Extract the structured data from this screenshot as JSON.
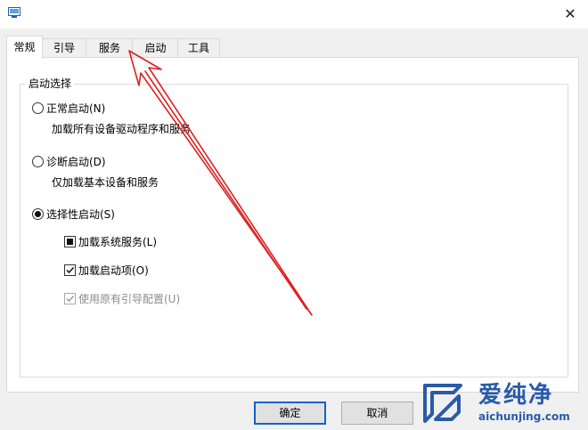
{
  "window": {
    "icon": "msconfig-icon",
    "close_symbol": "✕"
  },
  "tabs": [
    {
      "label": "常规",
      "active": true
    },
    {
      "label": "引导",
      "active": false
    },
    {
      "label": "服务",
      "active": false
    },
    {
      "label": "启动",
      "active": false
    },
    {
      "label": "工具",
      "active": false
    }
  ],
  "startup_selection": {
    "group_title": "启动选择",
    "options": [
      {
        "label": "正常启动(N)",
        "description": "加载所有设备驱动程序和服务",
        "selected": false
      },
      {
        "label": "诊断启动(D)",
        "description": "仅加载基本设备和服务",
        "selected": false
      },
      {
        "label": "选择性启动(S)",
        "selected": true
      }
    ],
    "selective_options": [
      {
        "label": "加载系统服务(L)",
        "state": "indeterminate",
        "enabled": true
      },
      {
        "label": "加载启动项(O)",
        "state": "checked",
        "enabled": true
      },
      {
        "label": "使用原有引导配置(U)",
        "state": "checked",
        "enabled": false
      }
    ]
  },
  "buttons": {
    "ok": "确定",
    "cancel": "取消"
  },
  "annotation": {
    "color": "#e02020",
    "target": "tab-services"
  },
  "watermark": {
    "name": "爱纯净",
    "url": "aichunjing.com",
    "color": "#2a5aa8"
  }
}
